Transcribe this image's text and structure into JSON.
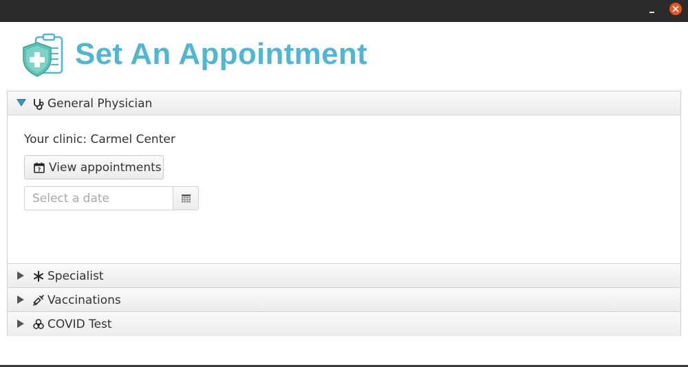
{
  "window": {
    "minimize_label": "–",
    "close_color": "#e95420"
  },
  "header": {
    "title": "Set An Appointment",
    "title_color": "#4fb6d3",
    "logo_icon": "medical-shield-clipboard-icon"
  },
  "accordion": {
    "sections": [
      {
        "label": "General Physician",
        "icon": "stethoscope-icon",
        "expanded": true
      },
      {
        "label": "Specialist",
        "icon": "asterisk-icon",
        "expanded": false
      },
      {
        "label": "Vaccinations",
        "icon": "syringe-icon",
        "expanded": false
      },
      {
        "label": "COVID Test",
        "icon": "biohazard-icon",
        "expanded": false
      }
    ],
    "general": {
      "clinic_text": "Your clinic: Carmel Center",
      "view_button_label": "View appointments",
      "date_placeholder": "Select a date",
      "date_value": ""
    }
  }
}
